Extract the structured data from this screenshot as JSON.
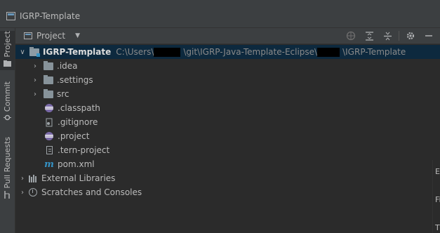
{
  "window": {
    "title": "IGRP-Template"
  },
  "sidebar": {
    "tabs": [
      {
        "label": "Project"
      },
      {
        "label": "Commit"
      },
      {
        "label": "Pull Requests"
      }
    ]
  },
  "toolbar": {
    "view_label": "Project"
  },
  "tree": {
    "root": {
      "name": "IGRP-Template",
      "path_part1": "C:\\Users\\",
      "path_part2": "\\git\\IGRP-Java-Template-Eclipse\\",
      "path_part3": "\\IGRP-Template"
    },
    "items": [
      {
        "label": ".idea"
      },
      {
        "label": ".settings"
      },
      {
        "label": "src"
      },
      {
        "label": ".classpath"
      },
      {
        "label": ".gitignore"
      },
      {
        "label": ".project"
      },
      {
        "label": ".tern-project"
      },
      {
        "label": "pom.xml"
      }
    ],
    "external_libraries": "External Libraries",
    "scratches": "Scratches and Consoles"
  },
  "edge_fragments": {
    "b": "E",
    "f": "Fi",
    "t": "T"
  }
}
